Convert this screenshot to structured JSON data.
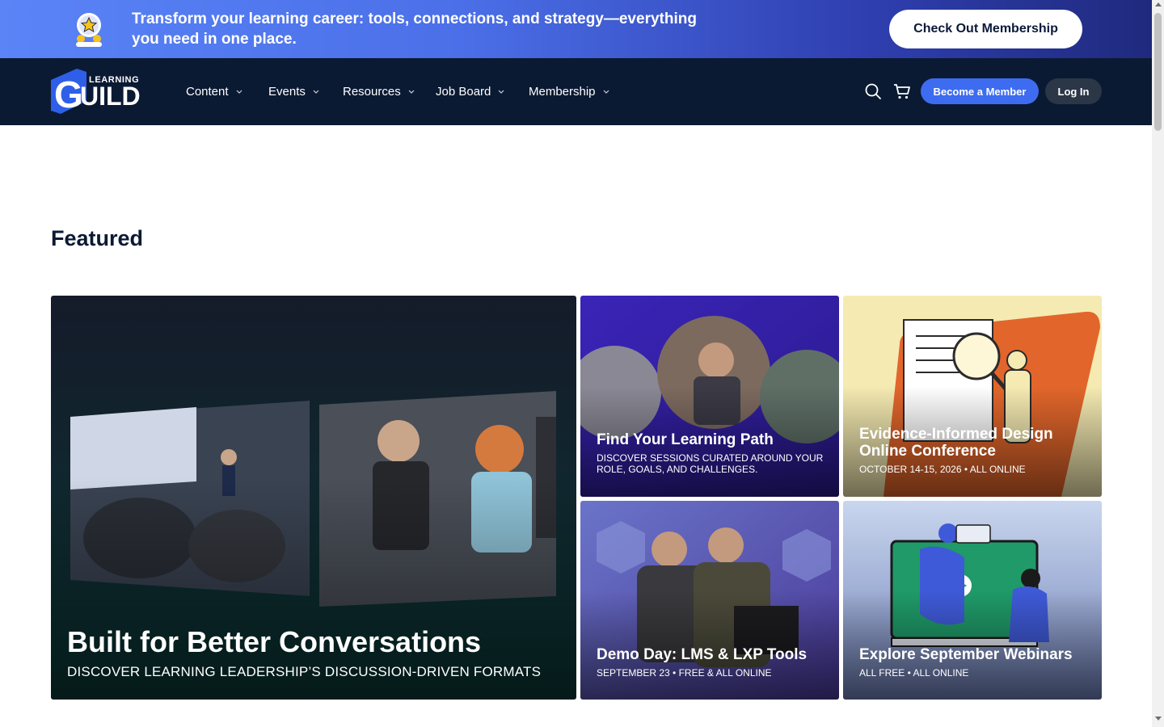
{
  "promo": {
    "text": "Transform your learning career: tools, connections, and strategy—everything you need in one place.",
    "button_label": "Check Out Membership"
  },
  "logo": {
    "small_text": "LEARNING",
    "big_text": "UILD",
    "g_letter": "G"
  },
  "nav": {
    "items": [
      {
        "label": "Content"
      },
      {
        "label": "Events"
      },
      {
        "label": "Resources"
      },
      {
        "label": "Job Board"
      },
      {
        "label": "Membership"
      }
    ],
    "become_member_label": "Become a Member",
    "login_label": "Log In"
  },
  "featured": {
    "heading": "Featured",
    "main": {
      "title": "Built for Better Conversations",
      "subtitle": "DISCOVER LEARNING LEADERSHIP’S DISCUSSION-DRIVEN FORMATS"
    },
    "cards": [
      {
        "title": "Find Your Learning Path",
        "subtitle": "DISCOVER SESSIONS CURATED AROUND YOUR ROLE, GOALS, AND CHALLENGES."
      },
      {
        "title": "Evidence-Informed Design Online Conference",
        "subtitle": "OCTOBER 14-15, 2026 • ALL ONLINE"
      },
      {
        "title": "Demo Day: LMS & LXP Tools",
        "subtitle": "SEPTEMBER 23 • FREE & ALL ONLINE"
      },
      {
        "title": "Explore September Webinars",
        "subtitle": "ALL FREE • ALL ONLINE"
      }
    ]
  },
  "colors": {
    "nav_bg": "#0b1a33",
    "accent": "#3d6cf0",
    "promo_start": "#5a84f7",
    "promo_end": "#1f2a7d"
  },
  "icons": [
    "member-badge-icon",
    "search-icon",
    "cart-icon",
    "chevron-down-icon"
  ]
}
